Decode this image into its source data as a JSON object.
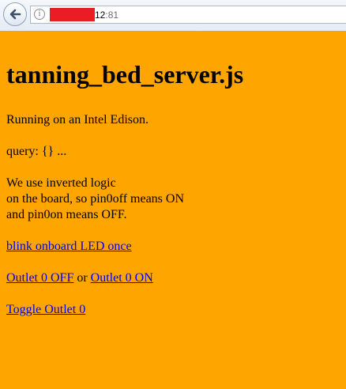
{
  "browser": {
    "info_icon": "i",
    "url_host": "12",
    "url_port": ":81",
    "back_icon": "back-arrow-icon"
  },
  "page": {
    "background": "#ffa500",
    "link_color": "#0000ee",
    "title": "tanning_bed_server.js",
    "running_text": "Running on an Intel Edison.",
    "query_text": "query: {} ...",
    "logic_lines": [
      "We use inverted logic",
      "on the board, so pin0off means ON",
      "and pin0on means OFF."
    ],
    "blink_link": "blink onboard LED once",
    "outlet_off_link": "Outlet 0 OFF",
    "or_text": " or ",
    "outlet_on_link": "Outlet 0 ON",
    "toggle_link": "Toggle Outlet 0"
  }
}
